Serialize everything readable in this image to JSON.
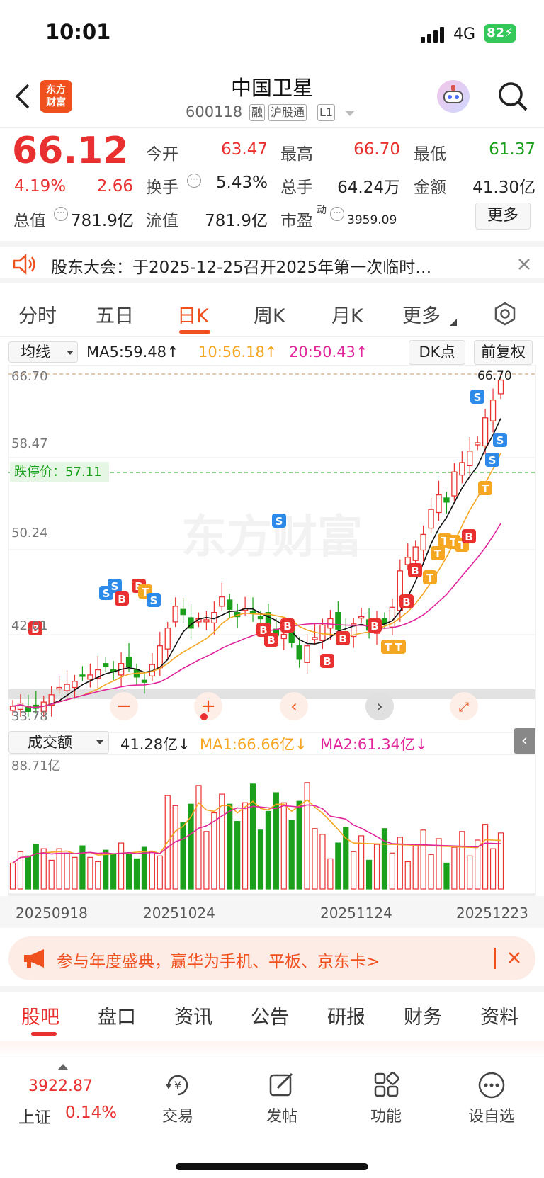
{
  "status": {
    "time": "10:01",
    "network": "4G",
    "battery": "82"
  },
  "header": {
    "title": "中国卫星",
    "code": "600118",
    "tags": [
      "融",
      "沪股通",
      "L1"
    ],
    "logo_lines": [
      "东方",
      "财富"
    ]
  },
  "quote": {
    "price": "66.12",
    "pct": "4.19%",
    "change": "2.66",
    "stats": [
      [
        "今开",
        "63.47"
      ],
      [
        "最高",
        "66.70"
      ],
      [
        "最低",
        "61.37"
      ],
      [
        "换手",
        "5.43%"
      ],
      [
        "总手",
        "64.24万"
      ],
      [
        "金额",
        "41.30亿"
      ]
    ],
    "mkt_cap_label": "总值",
    "mkt_cap": "781.9亿",
    "float_label": "流值",
    "float": "781.9亿",
    "pe_label": "市盈",
    "pe_sup": "动",
    "pe": "3959.09",
    "more": "更多"
  },
  "notice": {
    "text": "股东大会：于2025-12-25召开2025年第一次临时…"
  },
  "tabs": [
    "分时",
    "五日",
    "日K",
    "周K",
    "月K",
    "更多"
  ],
  "ma_bar": {
    "select": "均线",
    "ma5": "MA5:59.48",
    "ma10": "10:56.18",
    "ma20": "20:50.43",
    "dk": "DK点",
    "fq": "前复权"
  },
  "kchart": {
    "max_label": "66.70",
    "max_tag": "66.70",
    "price_levels": [
      "58.47",
      "50.24",
      "42.01",
      "33.78"
    ],
    "limit_down_text": "跌停价：57.11",
    "watermark": "东方财富"
  },
  "vol_bar": {
    "select": "成交额",
    "value": "41.28亿",
    "ma1": "MA1:66.66亿",
    "ma2": "MA2:61.34亿",
    "max_label": "88.71亿"
  },
  "dates": [
    "20250918",
    "20251024",
    "20251124",
    "20251223"
  ],
  "banner": {
    "text": "参与年度盛典，赢华为手机、平板、京东卡>"
  },
  "subtabs": [
    "股吧",
    "盘口",
    "资讯",
    "公告",
    "研报",
    "财务",
    "资料"
  ],
  "bottom": {
    "index_value": "3922.87",
    "index_name": "上证",
    "index_pct": "0.14%",
    "items": [
      "交易",
      "发帖",
      "功能",
      "设自选"
    ]
  },
  "colors": {
    "up": "#e93030",
    "down": "#1aa01a",
    "accent": "#f0501e",
    "ma10": "#f5a623",
    "ma20": "#e0249a"
  },
  "chart_data": {
    "type": "candlestick",
    "x_range": [
      "20250918",
      "20251226"
    ],
    "ylim": [
      33.78,
      66.7
    ],
    "series": [
      {
        "name": "MA5",
        "last": 59.48
      },
      {
        "name": "MA10",
        "last": 56.18
      },
      {
        "name": "MA20",
        "last": 50.43
      }
    ],
    "close_approx": [
      34.8,
      35.1,
      34.3,
      34.6,
      35.2,
      35.9,
      36.6,
      36.9,
      37.2,
      37.7,
      37.8,
      38.3,
      38.6,
      38.1,
      38.9,
      38.6,
      37.6,
      37.1,
      38.8,
      40.6,
      42.3,
      44.4,
      43.6,
      42.3,
      43.2,
      43.1,
      43.8,
      45.3,
      44.1,
      43.4,
      44.2,
      43.7,
      43.2,
      42.5,
      41.6,
      41.7,
      40.9,
      39.3,
      40.6,
      41.4,
      42.6,
      43.2,
      42.2,
      41.8,
      42.7,
      43.4,
      42.1,
      42.6,
      42.7,
      44.3,
      47.8,
      49.1,
      50.1,
      51.3,
      53.7,
      55.1,
      54.4,
      57.3,
      58.2,
      59.3,
      60.1,
      62.5,
      64.2,
      66.12
    ]
  }
}
